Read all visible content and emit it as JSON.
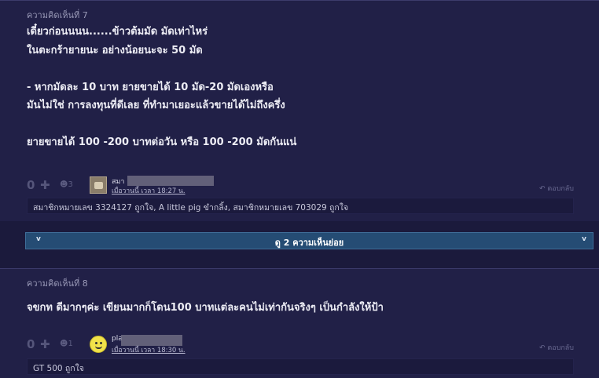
{
  "comment7": {
    "header": "ความคิดเห็นที่ 7",
    "lines": [
      "เดี๋ยวก่อนนนน......ข้าวต้มมัด มัดเท่าไหร่",
      "ในตะกร้ายายนะ อย่างน้อยนะจะ 50 มัด",
      "",
      "- หากมัดละ 10 บาท ยายขายได้ 10 มัด-20 มัดเองหรือ",
      "มันไม่ใช่ การลงทุนที่ดีเลย ที่ทำมาเยอะแล้วขายได้ไม่ถึงครึ่ง",
      "",
      "ยายขายได้ 100 -200 บาทต่อวัน หรือ 100 -200 มัดกันแน่"
    ],
    "votes": "0",
    "plus_icon": "plus-icon",
    "emotion_count": "3",
    "member_name": "สมา",
    "timestamp": "เมื่อวานนี้ เวลา 18:27 น.",
    "reply_label": "ตอบกลับ",
    "likes_text": "สมาชิกหมายเลข 3324127 ถูกใจ, A little pig ขำกลิ้ง, สมาชิกหมายเลข 703029 ถูกใจ"
  },
  "subreplies": {
    "label": "ดู 2 ความเห็นย่อย",
    "chevron_left": "v",
    "chevron_right": "v"
  },
  "comment8": {
    "header": "ความคิดเห็นที่ 8",
    "lines": [
      "จขกท ดีมากๆค่ะ เขียนมากก็โดน100 บาทแต่ละคนไม่เท่ากันจริงๆ เป็นกำลังให้ป้า"
    ],
    "votes": "0",
    "emotion_count": "1",
    "member_name": "pla",
    "timestamp": "เมื่อวานนี้ เวลา 18:30 น.",
    "reply_label": "ตอบกลับ",
    "likes_text": "GT 500 ถูกใจ"
  }
}
